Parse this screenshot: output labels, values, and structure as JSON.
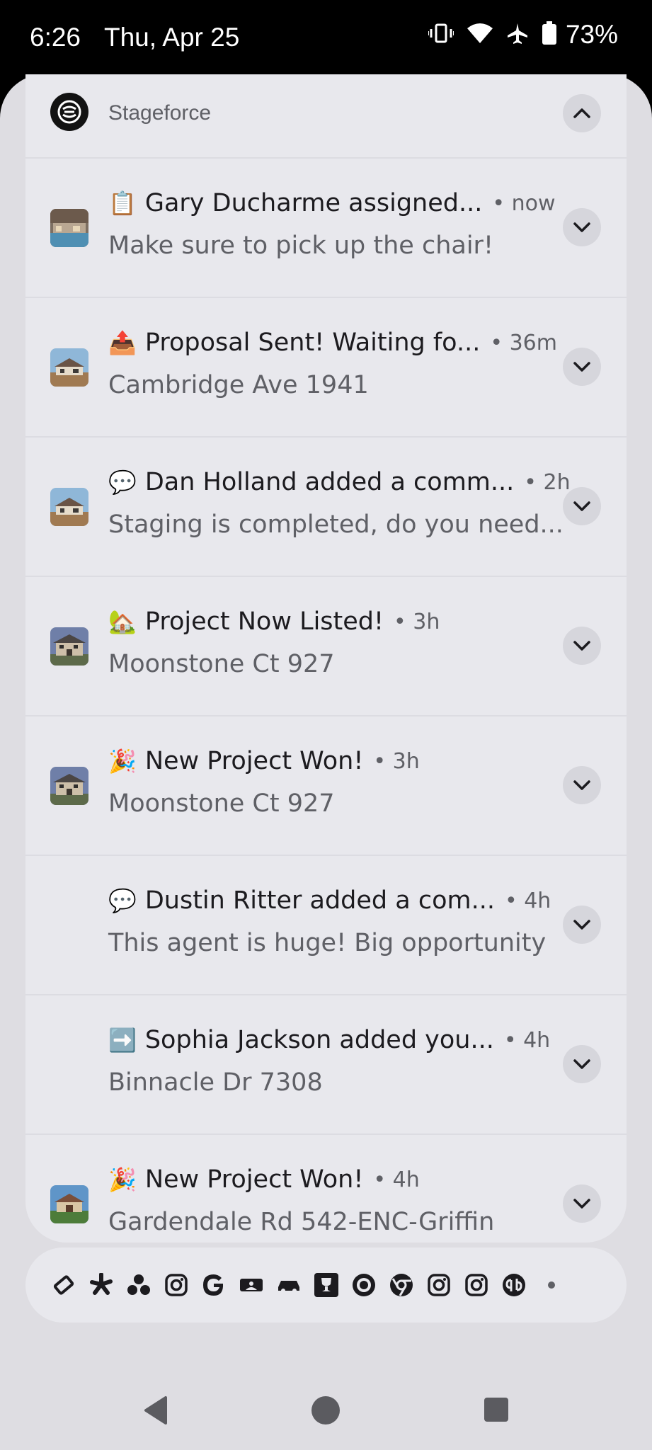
{
  "status_bar": {
    "time": "6:26",
    "date": "Thu, Apr 25",
    "battery_pct": "73%",
    "icons": [
      "vibrate-icon",
      "wifi-icon",
      "airplane-icon",
      "battery-icon"
    ]
  },
  "app": {
    "name": "Stageforce"
  },
  "notifications": [
    {
      "emoji": "📋",
      "title": "Gary Ducharme assigned...",
      "time": "• now",
      "body": "Make sure to pick up the chair!",
      "thumb": "pool-house"
    },
    {
      "emoji": "📤",
      "title": "Proposal Sent! Waiting fo...",
      "time": "• 36m",
      "body": "Cambridge Ave 1941",
      "thumb": "desert-house"
    },
    {
      "emoji": "💬",
      "title": "Dan Holland added a comm...",
      "time": "• 2h",
      "body": "Staging is completed, do you need...",
      "thumb": "desert-house"
    },
    {
      "emoji": "🏡",
      "title": "Project Now Listed!",
      "time": "• 3h",
      "body": "Moonstone Ct 927",
      "thumb": "two-story-house"
    },
    {
      "emoji": "🎉",
      "title": "New Project Won!",
      "time": "• 3h",
      "body": "Moonstone Ct 927",
      "thumb": "two-story-house"
    },
    {
      "emoji": "💬",
      "title": "Dustin Ritter added a com...",
      "time": "• 4h",
      "body": "This agent is huge! Big opportunity",
      "thumb": ""
    },
    {
      "emoji": "➡️",
      "title": "Sophia Jackson added you...",
      "time": "• 4h",
      "body": "Binnacle Dr 7308",
      "thumb": ""
    },
    {
      "emoji": "🎉",
      "title": "New Project Won!",
      "time": "• 4h",
      "body": "Gardendale Rd 542-ENC-Griffin",
      "thumb": "garden-house"
    }
  ],
  "dock_icons": [
    "ticket-icon",
    "yelp-icon",
    "dots-icon",
    "instagram-icon",
    "google-icon",
    "mlb-icon",
    "rental-car-icon",
    "trophy-icon",
    "record-icon",
    "chrome-icon",
    "instagram-icon",
    "instagram-icon",
    "quickbooks-icon",
    "more-dot-icon"
  ],
  "colors": {
    "shade_bg": "#dedde2",
    "card_bg": "#e8e8ed",
    "button_bg": "#d6d6dc"
  }
}
